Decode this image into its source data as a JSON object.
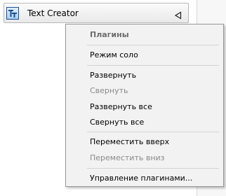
{
  "plugin": {
    "title": "Text Creator",
    "icon": "text-creator-icon"
  },
  "context_menu": {
    "header": "Плагины",
    "items": [
      {
        "label": "Режим соло",
        "enabled": true
      },
      {
        "label": "Развернуть",
        "enabled": true
      },
      {
        "label": "Свернуть",
        "enabled": false
      },
      {
        "label": "Развернуть все",
        "enabled": true
      },
      {
        "label": "Свернуть все",
        "enabled": true
      },
      {
        "label": "Переместить вверх",
        "enabled": true
      },
      {
        "label": "Переместить вниз",
        "enabled": false
      },
      {
        "label": "Управление плагинами...",
        "enabled": true
      }
    ]
  },
  "colors": {
    "menu_bg": "#f2f2f2",
    "menu_border": "#979797",
    "disabled_text": "#8a8a8a",
    "icon_blue": "#1d4d8f"
  }
}
